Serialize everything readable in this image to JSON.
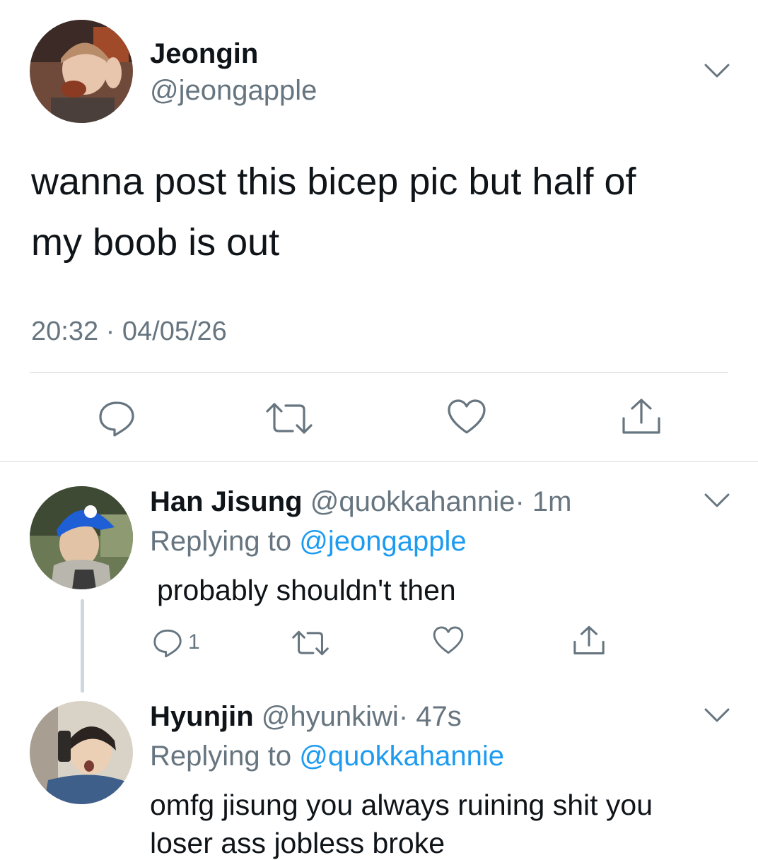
{
  "main_tweet": {
    "author_name": "Jeongin",
    "author_handle": "@jeongapple",
    "text_line1": "wanna post this bicep pic but half of",
    "text_line2": "my boob is out",
    "timestamp": "20:32 · 04/05/26",
    "actions": [
      "reply-icon",
      "retweet-icon",
      "like-icon",
      "share-icon"
    ]
  },
  "replies": [
    {
      "author_name": "Han Jisung",
      "author_handle": "@quokkahannie",
      "time": "· 1m",
      "replying_prefix": "Replying to",
      "replying_to": "@jeongapple",
      "text": "probably shouldn't then",
      "reply_count": "1"
    },
    {
      "author_name": "Hyunjin",
      "author_handle": "@hyunkiwi",
      "time": "· 47s",
      "replying_prefix": "Replying to",
      "replying_to": "@quokkahannie",
      "text_line1": "omfg jisung you always ruining shit you",
      "text_line2": "loser ass jobless broke"
    }
  ],
  "colors": {
    "link": "#1d9bf0",
    "muted": "#66757f",
    "divider": "#d6dbe0"
  }
}
